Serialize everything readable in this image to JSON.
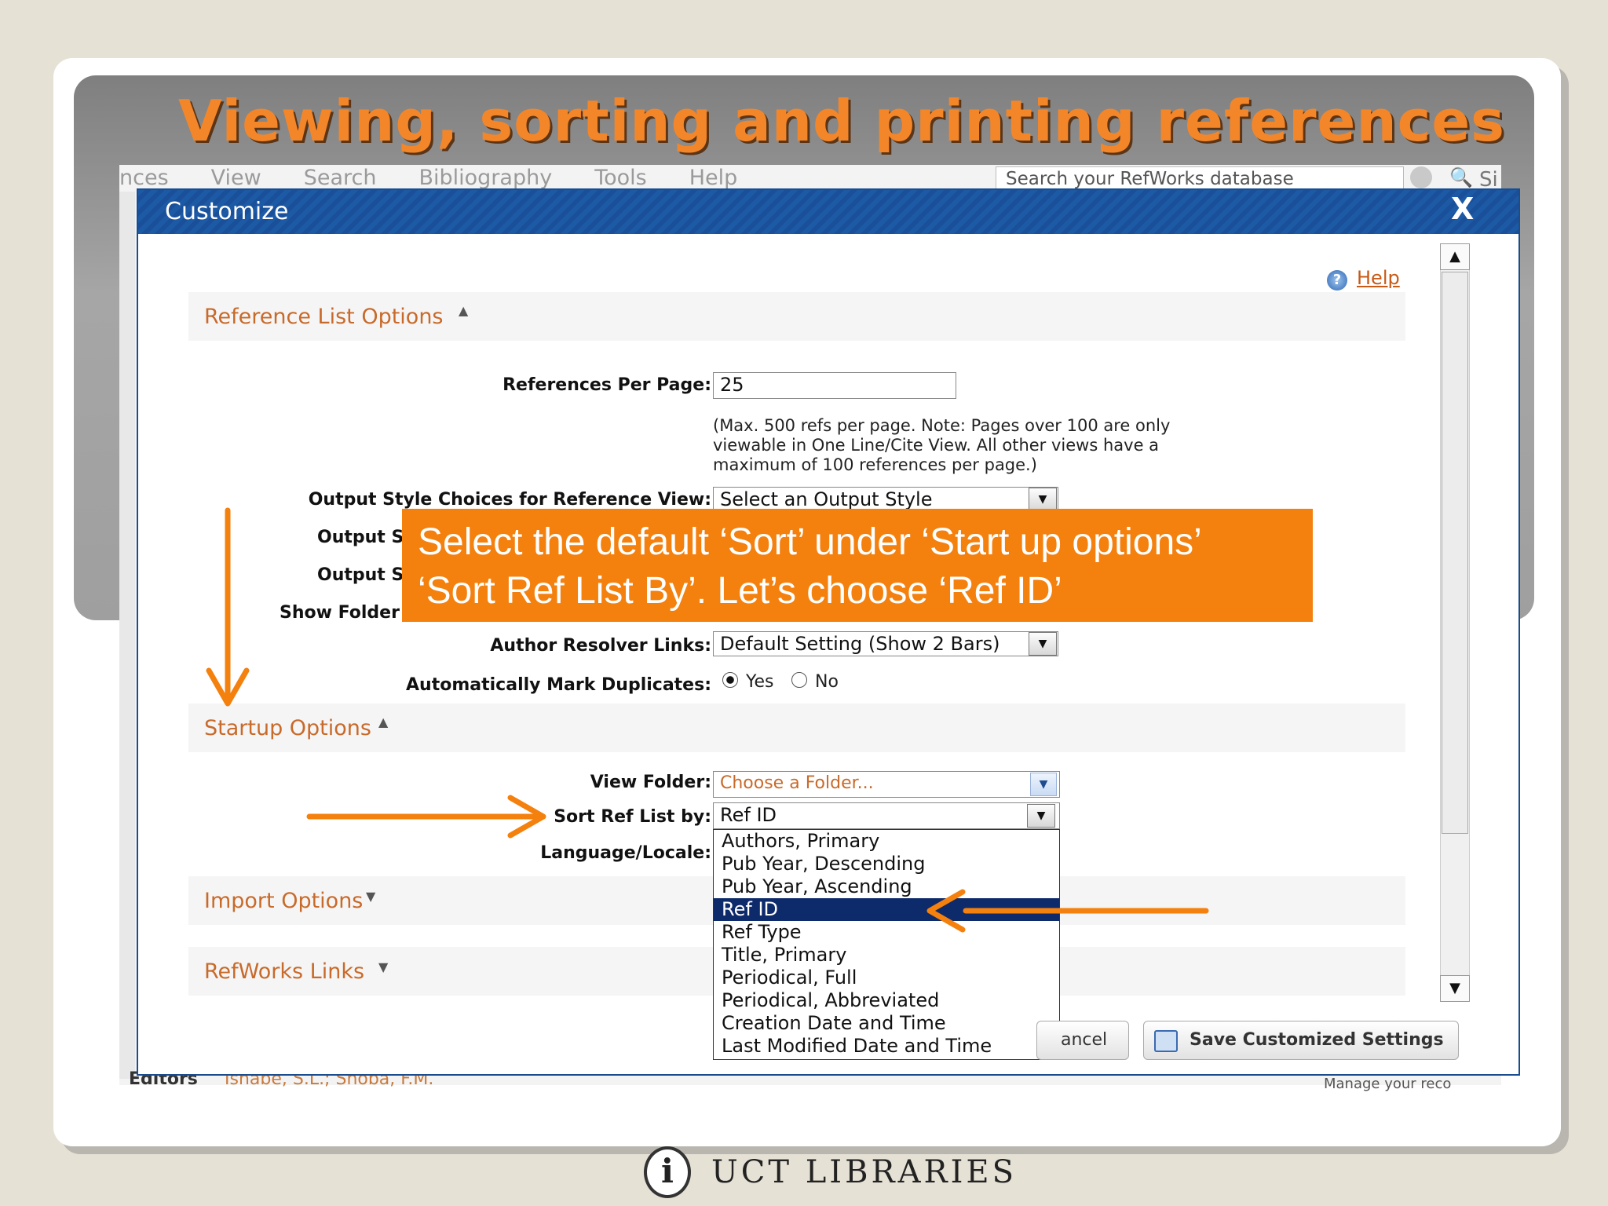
{
  "slide": {
    "title": "Viewing, sorting and printing references",
    "footer": "UCT  LIBRARIES",
    "logo_glyph": "i"
  },
  "app": {
    "menu": [
      "nces",
      "View",
      "Search",
      "Bibliography",
      "Tools",
      "Help"
    ],
    "search_placeholder": "Search your RefWorks database",
    "si_text": "Si",
    "editors_label": "Editors",
    "editors_value": "Ishabe, S.L.; Shoba, F.M.",
    "manage_text": "Manage your reco"
  },
  "modal": {
    "title": "Customize",
    "close_glyph": "X",
    "help_label": "Help",
    "help_icon_glyph": "?",
    "sections": {
      "reference_list": "Reference List Options",
      "startup": "Startup Options",
      "import": "Import Options",
      "links": "RefWorks Links"
    },
    "fields": {
      "refs_per_page_label": "References Per Page:",
      "refs_per_page_value": "25",
      "refs_note_1": "(Max. 500 refs per page. Note: Pages over 100 are only",
      "refs_note_2": "viewable in One Line/Cite View. All other views have a",
      "refs_note_3": "maximum of 100 references per page.)",
      "output_style_ref_label": "Output Style Choices for Reference View:",
      "output_style_ref_value": "Select an Output Style",
      "output_s2_label": "Output St",
      "output_s3_label": "Output St",
      "show_folder_label": "Show Folder",
      "author_resolver_label": "Author Resolver Links:",
      "author_resolver_value": "Default Setting (Show 2 Bars)",
      "auto_mark_label": "Automatically Mark Duplicates:",
      "yes_label": "Yes",
      "no_label": "No",
      "view_folder_label": "View Folder:",
      "view_folder_value": "Choose a Folder...",
      "sort_label": "Sort Ref List by:",
      "sort_value": "Ref ID",
      "language_label": "Language/Locale:"
    },
    "sort_options": [
      "Authors, Primary",
      "Pub Year, Descending",
      "Pub Year, Ascending",
      "Ref ID",
      "Ref Type",
      "Title, Primary",
      "Periodical, Full",
      "Periodical, Abbreviated",
      "Creation Date and Time",
      "Last Modified Date and Time"
    ],
    "sort_selected_index": 3,
    "cancel_label": "ancel",
    "save_label": "Save Customized Settings"
  },
  "callout": {
    "line1": "Select the default ‘Sort’ under ‘Start up options’",
    "line2": "‘Sort Ref List By’. Let’s choose ‘Ref ID’"
  },
  "colors": {
    "accent_orange": "#f4800e",
    "title_orange": "#f4862a",
    "modal_blue": "#1d5aa6",
    "selected_navy": "#0d2a6b"
  }
}
